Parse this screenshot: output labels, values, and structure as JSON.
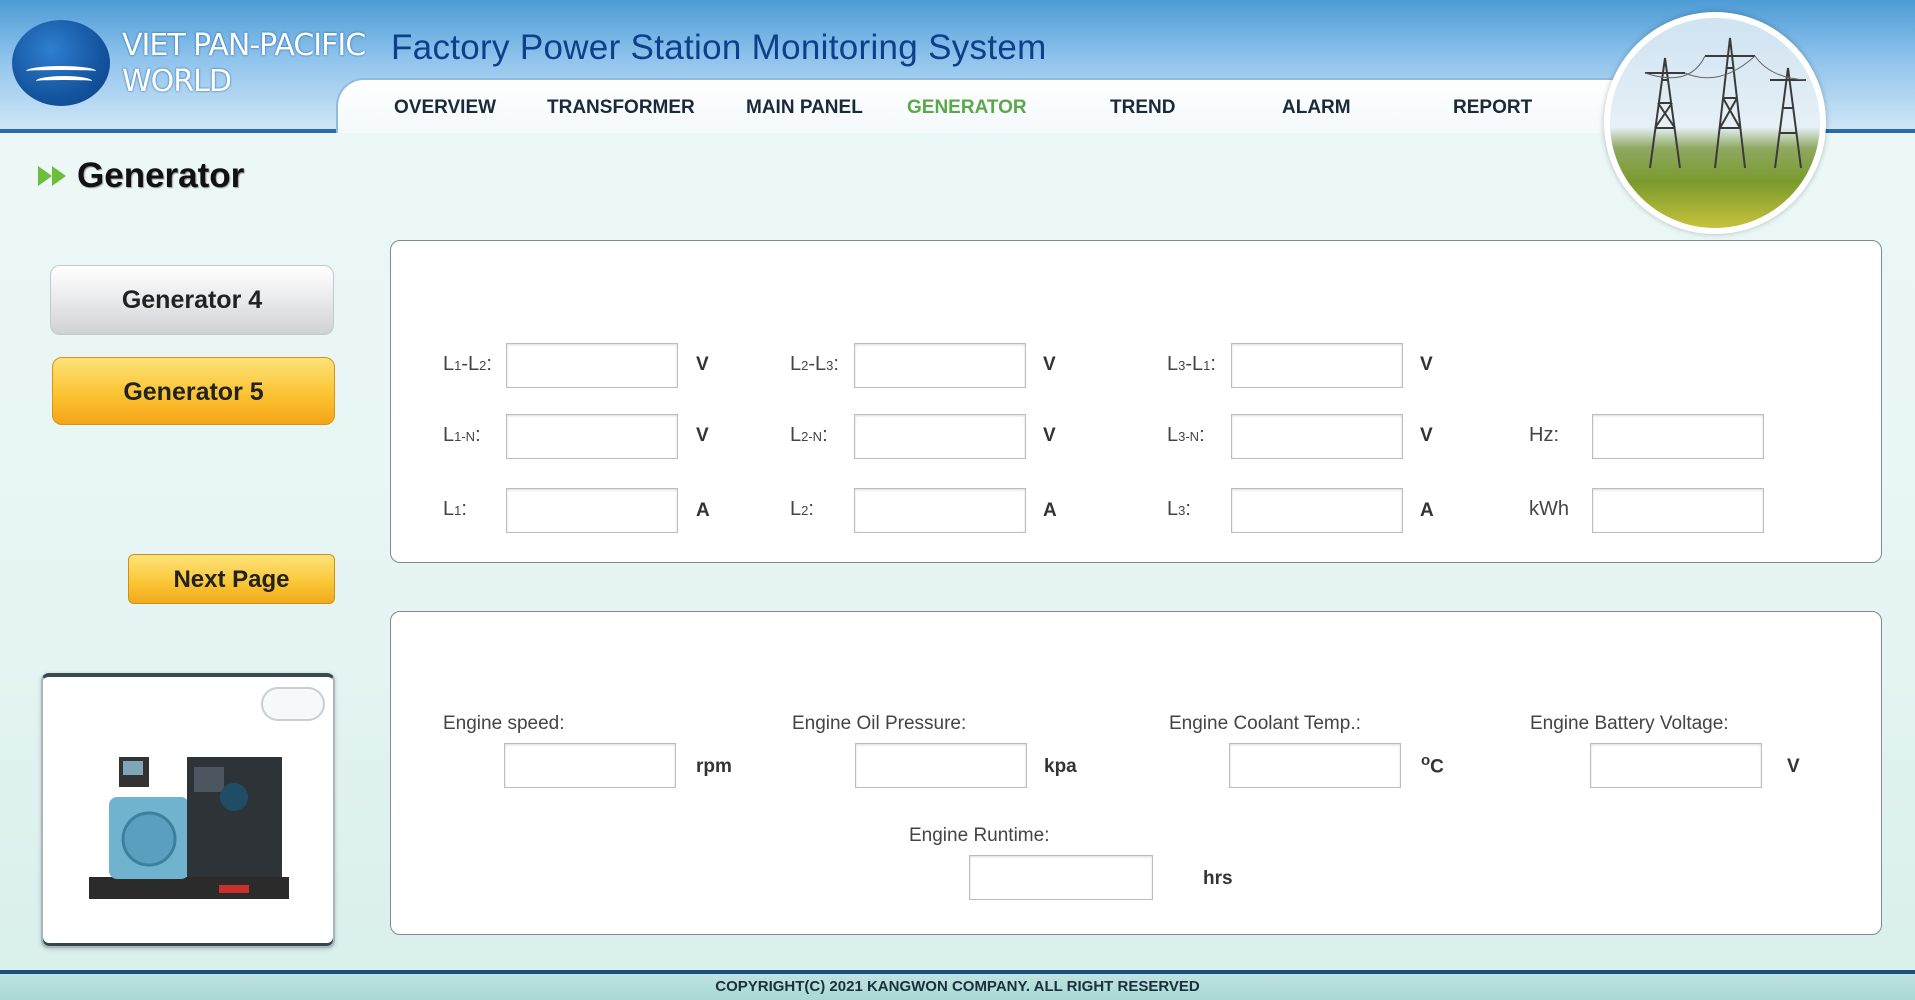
{
  "brand": {
    "line1": "VIET PAN-PACIFIC",
    "line2": "WORLD"
  },
  "app_title": "Factory Power Station Monitoring System",
  "nav": [
    {
      "label": "OVERVIEW"
    },
    {
      "label": "TRANSFORMER"
    },
    {
      "label": "MAIN PANEL"
    },
    {
      "label": "GENERATOR",
      "active": true
    },
    {
      "label": "TREND"
    },
    {
      "label": "ALARM"
    },
    {
      "label": "REPORT"
    }
  ],
  "page_title": "Generator",
  "sidebar": {
    "generator_4": "Generator 4",
    "generator_5": "Generator 5",
    "next_page": "Next Page"
  },
  "electrical": {
    "l1_l2": {
      "label_a": "L",
      "sub_a": "1",
      "label_b": "-L",
      "sub_b": "2",
      "label_end": ":",
      "value": "",
      "unit": "V"
    },
    "l2_l3": {
      "label_a": "L",
      "sub_a": "2",
      "label_b": "-L",
      "sub_b": "3",
      "label_end": ":",
      "value": "",
      "unit": "V"
    },
    "l3_l1": {
      "label_a": "L",
      "sub_a": "3",
      "label_b": "-L",
      "sub_b": "1",
      "label_end": ":",
      "value": "",
      "unit": "V"
    },
    "l1_n": {
      "label_a": "L",
      "sub_a": "1-N",
      "label_end": ":",
      "value": "",
      "unit": "V"
    },
    "l2_n": {
      "label_a": "L",
      "sub_a": "2-N",
      "label_end": ":",
      "value": "",
      "unit": "V"
    },
    "l3_n": {
      "label_a": "L",
      "sub_a": "3-N",
      "label_end": ":",
      "value": "",
      "unit": "V"
    },
    "hz": {
      "label": "Hz:",
      "value": ""
    },
    "l1": {
      "label_a": "L",
      "sub_a": "1",
      "label_end": ":",
      "value": "",
      "unit": "A"
    },
    "l2": {
      "label_a": "L",
      "sub_a": "2",
      "label_end": ":",
      "value": "",
      "unit": "A"
    },
    "l3": {
      "label_a": "L",
      "sub_a": "3",
      "label_end": ":",
      "value": "",
      "unit": "A"
    },
    "kwh": {
      "label": "kWh",
      "value": ""
    }
  },
  "engine": {
    "speed": {
      "label": "Engine speed:",
      "value": "",
      "unit": "rpm"
    },
    "oil_pressure": {
      "label": "Engine Oil Pressure:",
      "value": "",
      "unit": "kpa"
    },
    "coolant_temp": {
      "label": "Engine Coolant Temp.:",
      "value": "",
      "unit_sup": "o",
      "unit": "C"
    },
    "battery_voltage": {
      "label": "Engine Battery Voltage:",
      "value": "",
      "unit": "V"
    },
    "runtime": {
      "label": "Engine Runtime:",
      "value": "",
      "unit": "hrs"
    }
  },
  "footer": "COPYRIGHT(C) 2021 KANGWON COMPANY. ALL RIGHT RESERVED",
  "colors": {
    "header_blue": "#2a6aa5",
    "active_nav": "#5aa84a",
    "button_orange": "#fbc432"
  }
}
